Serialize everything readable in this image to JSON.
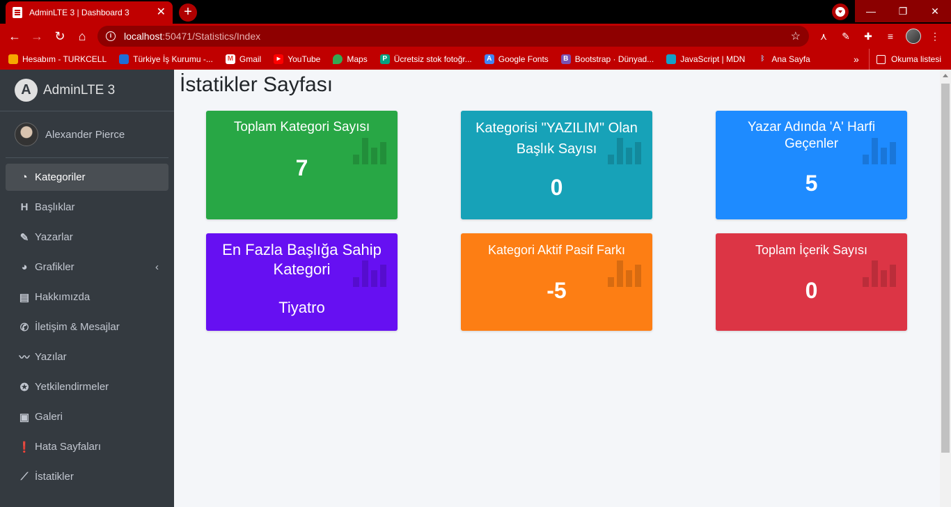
{
  "browser": {
    "tab_title": "AdminLTE 3 | Dashboard 3",
    "url_host": "localhost",
    "url_rest": ":50471/Statistics/Index",
    "bookmarks": [
      {
        "label": "Hesabım - TURKCELL",
        "color": "#f6a800"
      },
      {
        "label": "Türkiye İş Kurumu -...",
        "color": "#1e6ed6"
      },
      {
        "label": "Gmail",
        "color": "#ea4335"
      },
      {
        "label": "YouTube",
        "color": "#ff0000"
      },
      {
        "label": "Maps",
        "color": "#34a853"
      },
      {
        "label": "Ücretsiz stok fotoğr...",
        "color": "#05a081"
      },
      {
        "label": "Google Fonts",
        "color": "#4285f4"
      },
      {
        "label": "Bootstrap · Dünyad...",
        "color": "#7952b3"
      },
      {
        "label": "JavaScript | MDN",
        "color": "#15a0c8"
      },
      {
        "label": "Ana Sayfa",
        "color": "#3b5998"
      }
    ],
    "reading_list": "Okuma listesi"
  },
  "sidebar": {
    "brand": "AdminLTE 3",
    "user": "Alexander Pierce",
    "items": [
      {
        "label": "Kategoriler",
        "icon": "tachometer-icon",
        "glyph": "◔",
        "active": true
      },
      {
        "label": "Başlıklar",
        "icon": "heading-icon",
        "glyph": "H"
      },
      {
        "label": "Yazarlar",
        "icon": "pen-icon",
        "glyph": "✎"
      },
      {
        "label": "Grafikler",
        "icon": "chart-pie-icon",
        "glyph": "◕",
        "chevron": true
      },
      {
        "label": "Hakkımızda",
        "icon": "id-card-icon",
        "glyph": "▤"
      },
      {
        "label": "İletişim & Mesajlar",
        "icon": "phone-icon",
        "glyph": "✆"
      },
      {
        "label": "Yazılar",
        "icon": "signature-icon",
        "glyph": "〰"
      },
      {
        "label": "Yetkilendirmeler",
        "icon": "award-icon",
        "glyph": "✪"
      },
      {
        "label": "Galeri",
        "icon": "image-icon",
        "glyph": "▣"
      },
      {
        "label": "Hata Sayfaları",
        "icon": "exclamation-icon",
        "glyph": "❗"
      },
      {
        "label": "İstatikler",
        "icon": "chart-line-icon",
        "glyph": "⟋"
      }
    ]
  },
  "content": {
    "title": "İstatikler Sayfası",
    "cards": [
      {
        "title": "Toplam Kategori Sayısı",
        "value": "7",
        "color": "#28a745"
      },
      {
        "title": "Kategorisi \"YAZILIM\" Olan Başlık Sayısı",
        "value": "0",
        "color": "#17a2b8"
      },
      {
        "title": "Yazar Adında 'A' Harfi Geçenler",
        "value": "5",
        "color": "#1e8bff"
      },
      {
        "title": "En Fazla Başlığa Sahip Kategori",
        "value": "Tiyatro",
        "color": "#6610f2"
      },
      {
        "title": "Kategori Aktif Pasif Farkı",
        "value": "-5",
        "color": "#fd7e14"
      },
      {
        "title": "Toplam İçerik Sayısı",
        "value": "0",
        "color": "#dc3545"
      }
    ]
  }
}
